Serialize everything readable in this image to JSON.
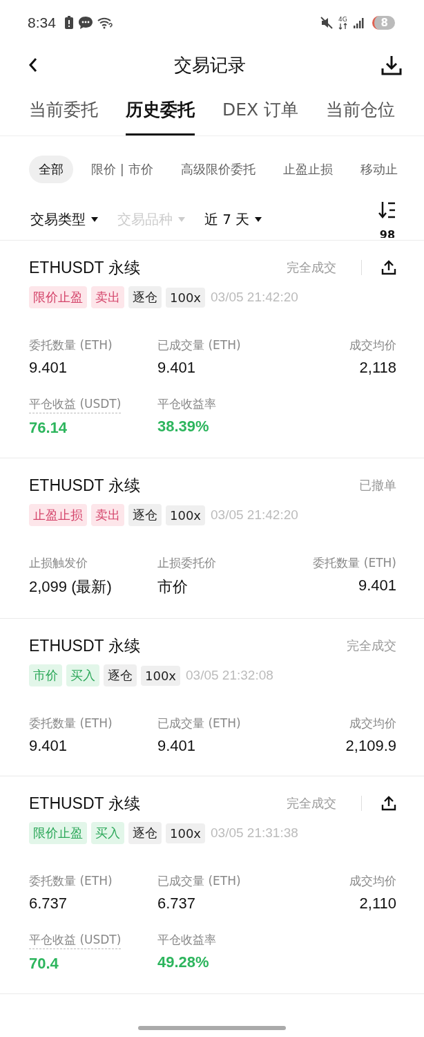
{
  "status_bar": {
    "time": "8:34",
    "battery_badge": "8",
    "network": "4G"
  },
  "header": {
    "title": "交易记录"
  },
  "tabs": [
    {
      "label": "当前委托",
      "selected": false
    },
    {
      "label": "历史委托",
      "selected": true
    },
    {
      "label": "DEX 订单",
      "selected": false
    },
    {
      "label": "当前仓位",
      "selected": false
    }
  ],
  "chips": [
    {
      "label": "全部",
      "selected": true
    },
    {
      "label": "限价 | 市价",
      "selected": false
    },
    {
      "label": "高级限价委托",
      "selected": false
    },
    {
      "label": "止盈止损",
      "selected": false
    },
    {
      "label": "移动止",
      "selected": false
    }
  ],
  "filters": [
    {
      "label": "交易类型",
      "disabled": false
    },
    {
      "label": "交易品种",
      "disabled": true
    },
    {
      "label": "近 7 天",
      "disabled": false
    }
  ],
  "sort_count": "98",
  "orders": [
    {
      "title": "ETHUSDT 永续",
      "status": "完全成交",
      "share": true,
      "tags": [
        {
          "label": "限价止盈",
          "kind": "sell"
        },
        {
          "label": "卖出",
          "kind": "sell"
        },
        {
          "label": "逐仓",
          "kind": "neutral"
        },
        {
          "label": "100x",
          "kind": "neutral"
        }
      ],
      "time": "03/05 21:42:20",
      "fields": [
        {
          "label": "委托数量 (ETH)",
          "value": "9.401",
          "dotted": false,
          "positive": false
        },
        {
          "label": "已成交量 (ETH)",
          "value": "9.401",
          "dotted": false,
          "positive": false
        },
        {
          "label": "成交均价",
          "value": "2,118",
          "dotted": false,
          "positive": false
        },
        {
          "label": "平仓收益 (USDT)",
          "value": "76.14",
          "dotted": true,
          "positive": true
        },
        {
          "label": "平仓收益率",
          "value": "38.39%",
          "dotted": false,
          "positive": true
        }
      ]
    },
    {
      "title": "ETHUSDT 永续",
      "status": "已撤单",
      "share": false,
      "tags": [
        {
          "label": "止盈止损",
          "kind": "sell"
        },
        {
          "label": "卖出",
          "kind": "sell"
        },
        {
          "label": "逐仓",
          "kind": "neutral"
        },
        {
          "label": "100x",
          "kind": "neutral"
        }
      ],
      "time": "03/05 21:42:20",
      "fields": [
        {
          "label": "止损触发价",
          "value": "2,099 (最新)",
          "dotted": false,
          "positive": false
        },
        {
          "label": "止损委托价",
          "value": "市价",
          "dotted": false,
          "positive": false
        },
        {
          "label": "委托数量 (ETH)",
          "value": "9.401",
          "dotted": false,
          "positive": false
        }
      ]
    },
    {
      "title": "ETHUSDT 永续",
      "status": "完全成交",
      "share": false,
      "tags": [
        {
          "label": "市价",
          "kind": "buy"
        },
        {
          "label": "买入",
          "kind": "buy"
        },
        {
          "label": "逐仓",
          "kind": "neutral"
        },
        {
          "label": "100x",
          "kind": "neutral"
        }
      ],
      "time": "03/05 21:32:08",
      "fields": [
        {
          "label": "委托数量 (ETH)",
          "value": "9.401",
          "dotted": false,
          "positive": false
        },
        {
          "label": "已成交量 (ETH)",
          "value": "9.401",
          "dotted": false,
          "positive": false
        },
        {
          "label": "成交均价",
          "value": "2,109.9",
          "dotted": false,
          "positive": false
        }
      ]
    },
    {
      "title": "ETHUSDT 永续",
      "status": "完全成交",
      "share": true,
      "tags": [
        {
          "label": "限价止盈",
          "kind": "buy"
        },
        {
          "label": "买入",
          "kind": "buy"
        },
        {
          "label": "逐仓",
          "kind": "neutral"
        },
        {
          "label": "100x",
          "kind": "neutral"
        }
      ],
      "time": "03/05 21:31:38",
      "fields": [
        {
          "label": "委托数量 (ETH)",
          "value": "6.737",
          "dotted": false,
          "positive": false
        },
        {
          "label": "已成交量 (ETH)",
          "value": "6.737",
          "dotted": false,
          "positive": false
        },
        {
          "label": "成交均价",
          "value": "2,110",
          "dotted": false,
          "positive": false
        },
        {
          "label": "平仓收益 (USDT)",
          "value": "70.4",
          "dotted": true,
          "positive": true
        },
        {
          "label": "平仓收益率",
          "value": "49.28%",
          "dotted": false,
          "positive": true
        }
      ]
    }
  ]
}
